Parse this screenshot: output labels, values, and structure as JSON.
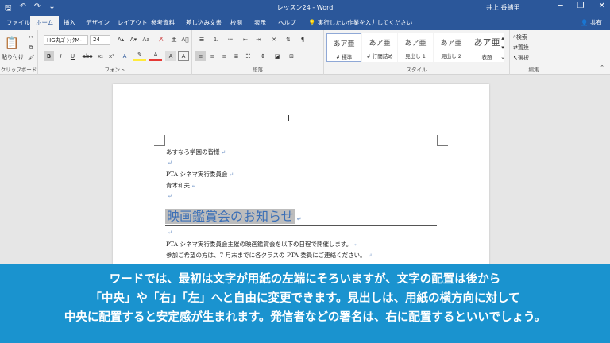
{
  "window": {
    "title": "レッスン24 - Word",
    "user": "井上 香緒里",
    "minimize": "─",
    "restore": "❐",
    "close": "✕"
  },
  "qat": {
    "save": "🖫",
    "undo": "↶",
    "redo": "↷",
    "customize": "⇣"
  },
  "tabs": [
    "ファイル",
    "ホーム",
    "挿入",
    "デザイン",
    "レイアウト",
    "参考資料",
    "差し込み文書",
    "校閲",
    "表示",
    "ヘルプ"
  ],
  "active_tab": "ホーム",
  "tellme": "実行したい作業を入力してください",
  "share": "共有",
  "ribbon": {
    "clipboard": {
      "paste": "貼り付け",
      "label": "クリップボード"
    },
    "font": {
      "font_name": "HG丸ｺﾞｼｯｸM-",
      "font_size": "24",
      "bold": "B",
      "italic": "I",
      "underline": "U",
      "strike": "abc",
      "sub": "x₂",
      "sup": "x²",
      "grow": "A▴",
      "shrink": "A▾",
      "case": "Aa",
      "label": "フォント"
    },
    "paragraph": {
      "label": "段落"
    },
    "styles": {
      "items": [
        {
          "sample": "あア亜",
          "name": "↲ 標準"
        },
        {
          "sample": "あア亜",
          "name": "↲ 行間詰め"
        },
        {
          "sample": "あア亜",
          "name": "見出し 1"
        },
        {
          "sample": "あア亜",
          "name": "見出し 2"
        },
        {
          "sample": "あア亜",
          "name": "表題"
        }
      ],
      "label": "スタイル"
    },
    "editing": {
      "find": "検索",
      "replace": "置換",
      "select": "選択",
      "label": "編集"
    }
  },
  "document": {
    "lines": [
      "あすなろ学園の皆様",
      "",
      "PTA シネマ実行委員会",
      "青木和夫",
      ""
    ],
    "heading": "映画鑑賞会のお知らせ",
    "body": [
      "",
      "PTA シネマ実行委員会主催の映画鑑賞会を以下の日程で開催します。",
      "参加ご希望の方は、7 月末までに各クラスの PTA 委員にご連絡ください。"
    ],
    "para_mark": "↵"
  },
  "caption": [
    "ワードでは、最初は文字が用紙の左端にそろいますが、文字の配置は後から",
    "「中央」や「右」「左」へと自由に変更できます。見出しは、用紙の横方向に対して",
    "中央に配置すると安定感が生まれます。発信者などの署名は、右に配置するといいでしょう。"
  ],
  "colors": {
    "accent": "#2b579a",
    "caption_bg": "#1a93cf",
    "heading_text": "#3b6fb6"
  }
}
